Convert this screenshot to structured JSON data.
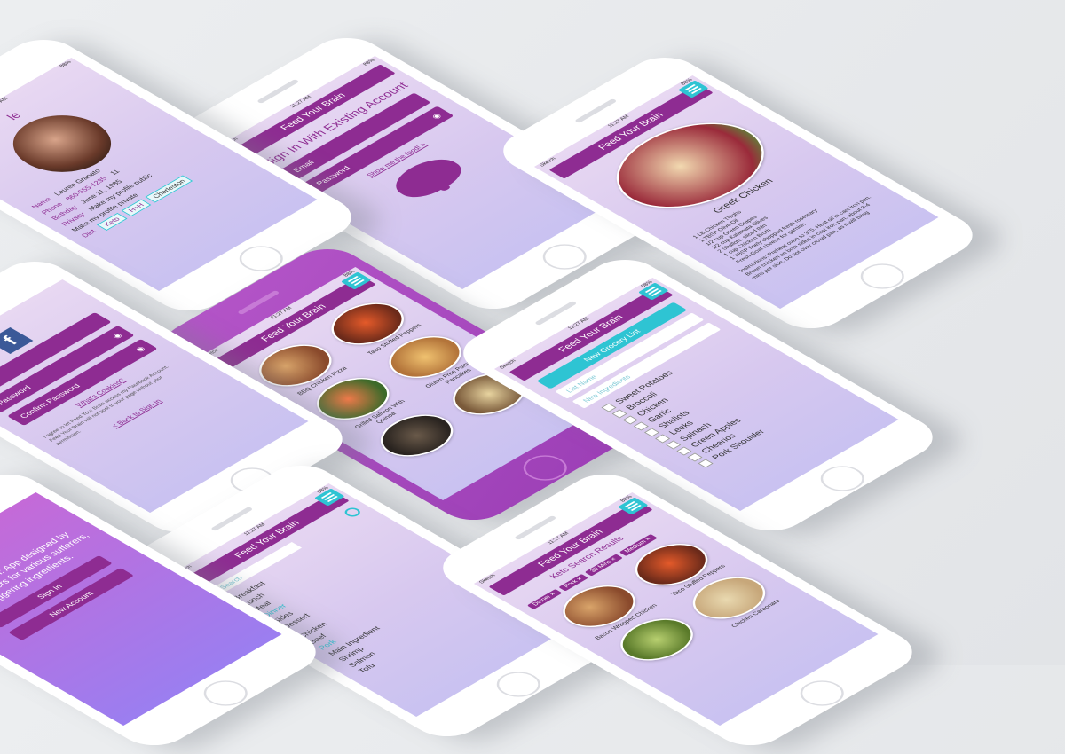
{
  "app_name": "Feed Your Brain",
  "status": {
    "carrier": "Sketch",
    "time": "11:27 AM",
    "battery": "88%"
  },
  "signin": {
    "title": "Sign In With Existing Account",
    "email_placeholder": "Email",
    "password_placeholder": "Password",
    "link": "Show me the food! >"
  },
  "recipes_grid": {
    "items": [
      {
        "label": "BBQ Chicken Pizza"
      },
      {
        "label": "Taco Stuffed Peppers"
      },
      {
        "label": "Gluten Free Pumpkin Pancakes"
      },
      {
        "label": "Grilled Salmon With Quinoa"
      },
      {
        "label": ""
      },
      {
        "label": ""
      }
    ]
  },
  "recipe_detail": {
    "title": "Greek Chicken",
    "ingredients": [
      "1 LB Chicken Thighs",
      "1 TBSP Olive Oil",
      "1/2 cup Green Grapes",
      "1/2 cup Kalamata Olives",
      "2 Shallots, sliced thin",
      "1 cup Chicken Broth",
      "1 TBSP finely chopped fresh rosemary",
      "Fresh Goat cheese for garnish"
    ],
    "instructions": "Instructions: Preheat oven to 375. Heat oil in cast iron pan. Brown chicken on both sides in cast iron pan, about 3-4 mins per side. Do not over crowd pan, as it will bring"
  },
  "grocery": {
    "new_list_button": "New Grocery List",
    "list_name_placeholder": "List Name",
    "new_ingredients_placeholder": "New Ingredients",
    "items": [
      "Sweet Potatoes",
      "Broccoli",
      "Chicken",
      "Garlic",
      "Shallots",
      "Leeks",
      "Spinach",
      "Green Apples",
      "Cheerios",
      "Pork Shoulder"
    ]
  },
  "profile": {
    "title": "le",
    "name_label": "Name",
    "name_value": "Lauren Granato",
    "phone_label": "Phone",
    "phone_value": "860-555-1235",
    "birthday_label": "Birthday",
    "birthday_value": "June 11, 1985",
    "privacy_label": "Privacy",
    "privacy_public": "Make my profile public",
    "privacy_private": "Make my profile private",
    "diet_label": "Diet",
    "diet_tags": [
      "Keto",
      "H+H",
      "Charleston"
    ],
    "age_value": "11"
  },
  "search": {
    "placeholder": "Search",
    "lines": [
      "Breakfast",
      "Lunch",
      "Dinner",
      "Sides",
      "Dessert"
    ],
    "meal_label": "Meal",
    "main_label": "Main Ingredient",
    "ingredients": [
      "Chicken",
      "Beef",
      "Pork",
      "Shrimp",
      "Salmon",
      "Tofu"
    ]
  },
  "search_results": {
    "title": "Keto Search Results",
    "chips": [
      "Dinner ×",
      "Pork ×",
      "30 Mins ×",
      "Medium ×"
    ],
    "items": [
      {
        "label": "Taco Stuffed Peppers"
      },
      {
        "label": "Bacon Wrapped Chicken"
      },
      {
        "label": "Chicken Carbonara"
      },
      {
        "label": ""
      }
    ]
  },
  "register": {
    "fb_glyph": "f",
    "password_placeholder": "Password",
    "confirm_placeholder": "Confirm Password",
    "whats_cooking": "What's Cooking?",
    "terms": "I agree to let Feed Your Brain access my Facebook Account. Feed Your Brain will not post to your page without your permission.",
    "back_link": "< Back to Sign In",
    "email_partial": "il"
  },
  "welcome": {
    "text": "Feed Your Brain: App designed by fast food lovers for various sufferers, without triggering ingredients.",
    "signin_button": "Sign In",
    "new_account_button": "New Account"
  }
}
